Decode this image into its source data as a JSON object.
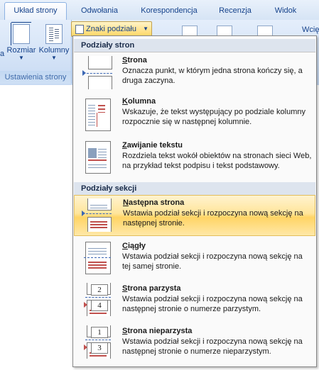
{
  "tabs": [
    {
      "label": "Układ strony",
      "active": true
    },
    {
      "label": "Odwołania",
      "active": false
    },
    {
      "label": "Korespondencja",
      "active": false
    },
    {
      "label": "Recenzja",
      "active": false
    },
    {
      "label": "Widok",
      "active": false
    }
  ],
  "ribbon": {
    "group_label": "Ustawienia strony",
    "left_btn_partial": "a",
    "rozmiar_label": "Rozmiar",
    "kolumny_label": "Kolumny",
    "znaki_label": "Znaki podziału",
    "right_partial": "Wcię"
  },
  "menu": {
    "section1": "Podziały stron",
    "section2": "Podziały sekcji",
    "items": [
      {
        "title": "Strona",
        "underline": "S",
        "rest": "trona",
        "desc": "Oznacza punkt, w którym jedna strona kończy się, a druga zaczyna.",
        "icon": "page-break-icon"
      },
      {
        "title": "Kolumna",
        "underline": "K",
        "rest": "olumna",
        "desc": "Wskazuje, że tekst występujący po podziale kolumny rozpocznie się w następnej kolumnie.",
        "icon": "column-break-icon"
      },
      {
        "title": "Zawijanie tekstu",
        "underline": "Z",
        "rest": "awijanie tekstu",
        "desc": "Rozdziela tekst wokół obiektów na stronach sieci Web, na przykład tekst podpisu i tekst podstawowy.",
        "icon": "text-wrapping-icon"
      },
      {
        "title": "Następna strona",
        "underline": "N",
        "rest": "astępna strona",
        "desc": "Wstawia podział sekcji i rozpoczyna nową sekcję na następnej stronie.",
        "icon": "next-page-icon",
        "highlighted": true
      },
      {
        "title": "Ciągły",
        "underline": "C",
        "rest": "iągły",
        "desc": "Wstawia podział sekcji i rozpoczyna nową sekcję na tej samej stronie.",
        "icon": "continuous-icon"
      },
      {
        "title": "Strona parzysta",
        "underline": "S",
        "rest": "trona parzysta",
        "desc": "Wstawia podział sekcji i rozpoczyna nową sekcję na następnej stronie o numerze parzystym.",
        "icon": "even-page-icon",
        "num_top": "2",
        "num_bottom": "4"
      },
      {
        "title": "Strona nieparzysta",
        "underline": "S",
        "rest": "trona nieparzysta",
        "desc": "Wstawia podział sekcji i rozpoczyna nową sekcję na następnej stronie o numerze nieparzystym.",
        "icon": "odd-page-icon",
        "num_top": "1",
        "num_bottom": "3"
      }
    ]
  }
}
